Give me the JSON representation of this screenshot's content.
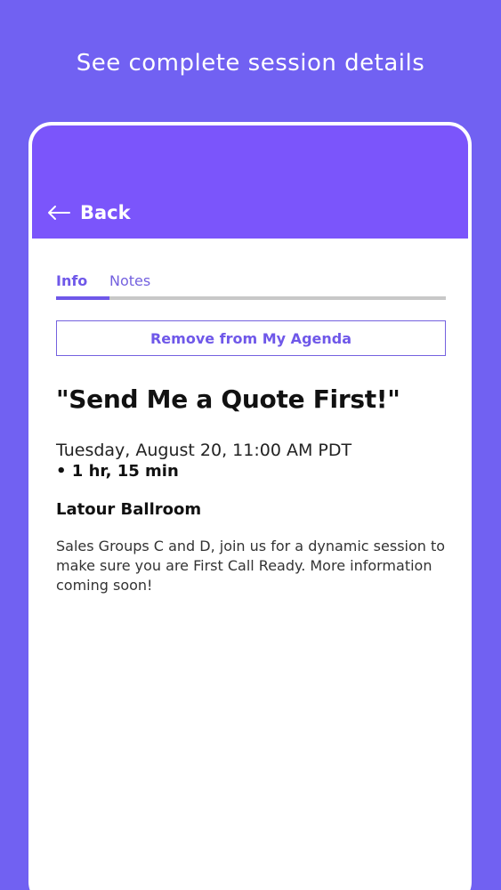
{
  "caption": "See complete session details",
  "header": {
    "back_label": "Back",
    "back_icon": "arrow-left-icon",
    "color": "#7b55fb"
  },
  "tabs": [
    {
      "label": "Info",
      "active": true
    },
    {
      "label": "Notes",
      "active": false
    }
  ],
  "agenda_button": {
    "label": "Remove from My Agenda"
  },
  "session": {
    "title": "\"Send Me a Quote First!\"",
    "datetime": "Tuesday, August 20, 11:00 AM PDT",
    "duration": "• 1 hr, 15 min",
    "location": "Latour Ballroom",
    "description": "Sales Groups C and D, join us for a dynamic session to make sure you are First Call Ready. More information coming soon!"
  },
  "colors": {
    "background": "#7161f2",
    "accent": "#6f58e9",
    "tab_track": "#c8c8c8"
  }
}
